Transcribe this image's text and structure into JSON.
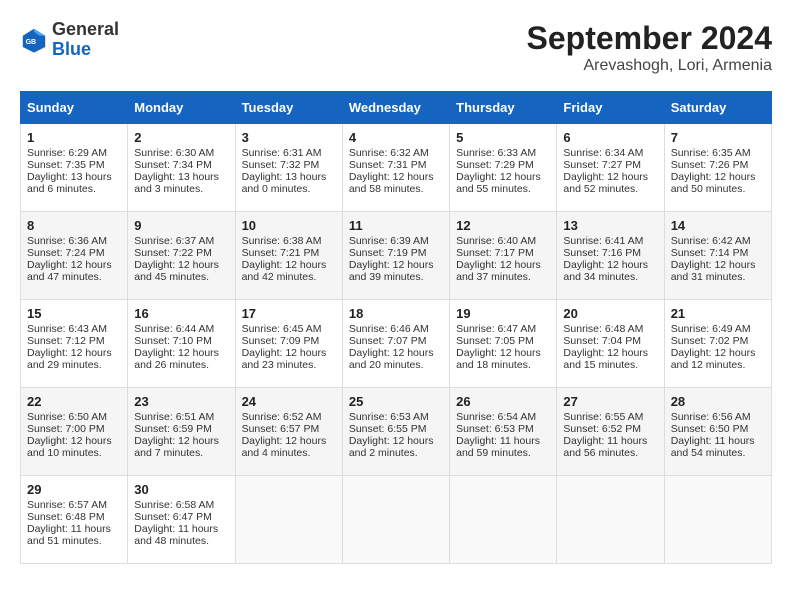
{
  "header": {
    "logo_general": "General",
    "logo_blue": "Blue",
    "month_year": "September 2024",
    "location": "Arevashogh, Lori, Armenia"
  },
  "columns": [
    "Sunday",
    "Monday",
    "Tuesday",
    "Wednesday",
    "Thursday",
    "Friday",
    "Saturday"
  ],
  "weeks": [
    [
      {
        "day": "1",
        "lines": [
          "Sunrise: 6:29 AM",
          "Sunset: 7:35 PM",
          "Daylight: 13 hours",
          "and 6 minutes."
        ]
      },
      {
        "day": "2",
        "lines": [
          "Sunrise: 6:30 AM",
          "Sunset: 7:34 PM",
          "Daylight: 13 hours",
          "and 3 minutes."
        ]
      },
      {
        "day": "3",
        "lines": [
          "Sunrise: 6:31 AM",
          "Sunset: 7:32 PM",
          "Daylight: 13 hours",
          "and 0 minutes."
        ]
      },
      {
        "day": "4",
        "lines": [
          "Sunrise: 6:32 AM",
          "Sunset: 7:31 PM",
          "Daylight: 12 hours",
          "and 58 minutes."
        ]
      },
      {
        "day": "5",
        "lines": [
          "Sunrise: 6:33 AM",
          "Sunset: 7:29 PM",
          "Daylight: 12 hours",
          "and 55 minutes."
        ]
      },
      {
        "day": "6",
        "lines": [
          "Sunrise: 6:34 AM",
          "Sunset: 7:27 PM",
          "Daylight: 12 hours",
          "and 52 minutes."
        ]
      },
      {
        "day": "7",
        "lines": [
          "Sunrise: 6:35 AM",
          "Sunset: 7:26 PM",
          "Daylight: 12 hours",
          "and 50 minutes."
        ]
      }
    ],
    [
      {
        "day": "8",
        "lines": [
          "Sunrise: 6:36 AM",
          "Sunset: 7:24 PM",
          "Daylight: 12 hours",
          "and 47 minutes."
        ]
      },
      {
        "day": "9",
        "lines": [
          "Sunrise: 6:37 AM",
          "Sunset: 7:22 PM",
          "Daylight: 12 hours",
          "and 45 minutes."
        ]
      },
      {
        "day": "10",
        "lines": [
          "Sunrise: 6:38 AM",
          "Sunset: 7:21 PM",
          "Daylight: 12 hours",
          "and 42 minutes."
        ]
      },
      {
        "day": "11",
        "lines": [
          "Sunrise: 6:39 AM",
          "Sunset: 7:19 PM",
          "Daylight: 12 hours",
          "and 39 minutes."
        ]
      },
      {
        "day": "12",
        "lines": [
          "Sunrise: 6:40 AM",
          "Sunset: 7:17 PM",
          "Daylight: 12 hours",
          "and 37 minutes."
        ]
      },
      {
        "day": "13",
        "lines": [
          "Sunrise: 6:41 AM",
          "Sunset: 7:16 PM",
          "Daylight: 12 hours",
          "and 34 minutes."
        ]
      },
      {
        "day": "14",
        "lines": [
          "Sunrise: 6:42 AM",
          "Sunset: 7:14 PM",
          "Daylight: 12 hours",
          "and 31 minutes."
        ]
      }
    ],
    [
      {
        "day": "15",
        "lines": [
          "Sunrise: 6:43 AM",
          "Sunset: 7:12 PM",
          "Daylight: 12 hours",
          "and 29 minutes."
        ]
      },
      {
        "day": "16",
        "lines": [
          "Sunrise: 6:44 AM",
          "Sunset: 7:10 PM",
          "Daylight: 12 hours",
          "and 26 minutes."
        ]
      },
      {
        "day": "17",
        "lines": [
          "Sunrise: 6:45 AM",
          "Sunset: 7:09 PM",
          "Daylight: 12 hours",
          "and 23 minutes."
        ]
      },
      {
        "day": "18",
        "lines": [
          "Sunrise: 6:46 AM",
          "Sunset: 7:07 PM",
          "Daylight: 12 hours",
          "and 20 minutes."
        ]
      },
      {
        "day": "19",
        "lines": [
          "Sunrise: 6:47 AM",
          "Sunset: 7:05 PM",
          "Daylight: 12 hours",
          "and 18 minutes."
        ]
      },
      {
        "day": "20",
        "lines": [
          "Sunrise: 6:48 AM",
          "Sunset: 7:04 PM",
          "Daylight: 12 hours",
          "and 15 minutes."
        ]
      },
      {
        "day": "21",
        "lines": [
          "Sunrise: 6:49 AM",
          "Sunset: 7:02 PM",
          "Daylight: 12 hours",
          "and 12 minutes."
        ]
      }
    ],
    [
      {
        "day": "22",
        "lines": [
          "Sunrise: 6:50 AM",
          "Sunset: 7:00 PM",
          "Daylight: 12 hours",
          "and 10 minutes."
        ]
      },
      {
        "day": "23",
        "lines": [
          "Sunrise: 6:51 AM",
          "Sunset: 6:59 PM",
          "Daylight: 12 hours",
          "and 7 minutes."
        ]
      },
      {
        "day": "24",
        "lines": [
          "Sunrise: 6:52 AM",
          "Sunset: 6:57 PM",
          "Daylight: 12 hours",
          "and 4 minutes."
        ]
      },
      {
        "day": "25",
        "lines": [
          "Sunrise: 6:53 AM",
          "Sunset: 6:55 PM",
          "Daylight: 12 hours",
          "and 2 minutes."
        ]
      },
      {
        "day": "26",
        "lines": [
          "Sunrise: 6:54 AM",
          "Sunset: 6:53 PM",
          "Daylight: 11 hours",
          "and 59 minutes."
        ]
      },
      {
        "day": "27",
        "lines": [
          "Sunrise: 6:55 AM",
          "Sunset: 6:52 PM",
          "Daylight: 11 hours",
          "and 56 minutes."
        ]
      },
      {
        "day": "28",
        "lines": [
          "Sunrise: 6:56 AM",
          "Sunset: 6:50 PM",
          "Daylight: 11 hours",
          "and 54 minutes."
        ]
      }
    ],
    [
      {
        "day": "29",
        "lines": [
          "Sunrise: 6:57 AM",
          "Sunset: 6:48 PM",
          "Daylight: 11 hours",
          "and 51 minutes."
        ]
      },
      {
        "day": "30",
        "lines": [
          "Sunrise: 6:58 AM",
          "Sunset: 6:47 PM",
          "Daylight: 11 hours",
          "and 48 minutes."
        ]
      },
      {
        "day": "",
        "lines": []
      },
      {
        "day": "",
        "lines": []
      },
      {
        "day": "",
        "lines": []
      },
      {
        "day": "",
        "lines": []
      },
      {
        "day": "",
        "lines": []
      }
    ]
  ]
}
